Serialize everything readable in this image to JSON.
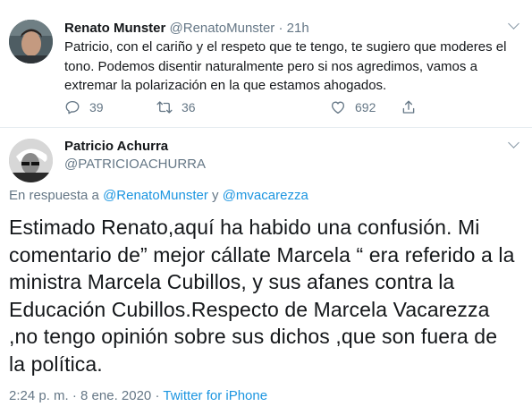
{
  "reply_tweet": {
    "name": "Renato Munster",
    "handle": "@RenatoMunster",
    "separator": "·",
    "time": "21h",
    "text": "Patricio, con el cariño y el respeto que te tengo, te sugiero que moderes el tono. Podemos disentir naturalmente pero si nos agredimos, vamos a extremar la polarización en la que estamos ahogados.",
    "replies": "39",
    "retweets": "36",
    "likes": "692",
    "icons": [
      "reply-icon",
      "retweet-icon",
      "like-icon",
      "share-icon"
    ]
  },
  "main_tweet": {
    "name": "Patricio Achurra",
    "handle": "@PATRICIOACHURRA",
    "reply_prefix": "En respuesta a",
    "reply_to_1": "@RenatoMunster",
    "reply_conj": "y",
    "reply_to_2": "@mvacarezza",
    "text": "Estimado Renato,aquí ha habido una confusión. Mi comentario de” mejor cállate Marcela “ era referido a la ministra Marcela Cubillos, y sus afanes contra la Educación Cubillos.Respecto de Marcela Vacarezza ,no tengo opinión sobre sus dichos ,que son fuera de la política.",
    "timestamp": "2:24 p. m. · 8 ene. 2020",
    "meta_separator": "·",
    "source": "Twitter for iPhone"
  },
  "colors": {
    "text": "#14171a",
    "secondary": "#657786",
    "link": "#1b95e0",
    "divider": "#e6ecf0"
  }
}
